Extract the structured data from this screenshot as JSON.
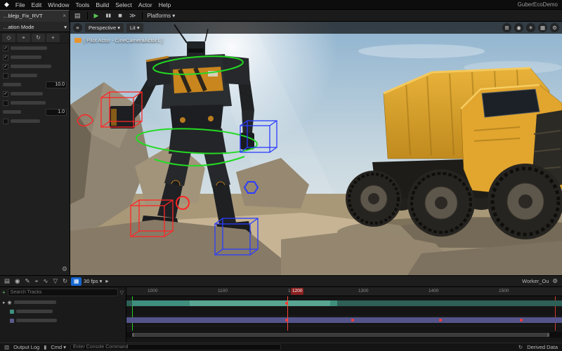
{
  "menubar": {
    "items": [
      "File",
      "Edit",
      "Window",
      "Tools",
      "Build",
      "Select",
      "Actor",
      "Help"
    ],
    "project": "GuberEcoDemo"
  },
  "toolbar": {
    "tab_label": "…blejp_Fix_RVT",
    "platforms_label": "Platforms"
  },
  "left_panel": {
    "mode_label": "…ation Mode",
    "value_1": "10.0",
    "value_2": "1.0"
  },
  "viewport": {
    "perspective_label": "Perspective",
    "lit_label": "Lit",
    "camera_label": "[ Pilot Actor - CineCameraActor1 ]"
  },
  "sequencer": {
    "fps_label": "30 fps",
    "sequence_label": "Worker_Ou",
    "search_placeholder": "Search Tracks",
    "current_frame": "1200",
    "ruler": [
      "1000",
      "1100",
      "1200",
      "1300",
      "1400",
      "1500"
    ]
  },
  "statusbar": {
    "output_log": "Output Log",
    "cmd": "Cmd",
    "console_placeholder": "Enter Console Command",
    "derived_data": "Derived Data"
  },
  "colors": {
    "accent_blue": "#1667d2",
    "play_green": "#58c458",
    "rig_green": "#23d923",
    "rig_red": "#ff2626",
    "rig_blue": "#2a3cff",
    "truck_yellow": "#d79b28"
  },
  "icons": {
    "logo": "◆",
    "close": "×",
    "caret_down": "▾",
    "save": "▤",
    "play": "▶",
    "pause": "▮▮",
    "stop": "◼",
    "skip": "≫",
    "hamburger": "≡",
    "maximize": "⊞",
    "camera": "◉",
    "sun": "☀",
    "grid": "▦",
    "gear": "⚙",
    "select": "◇",
    "target": "⌖",
    "loop": "↻",
    "plus": "+",
    "pencil": "✎",
    "curve": "∿",
    "funnel": "▽",
    "twisty": "▸",
    "check": "✓",
    "panel": "▥",
    "prompt": "▮"
  }
}
